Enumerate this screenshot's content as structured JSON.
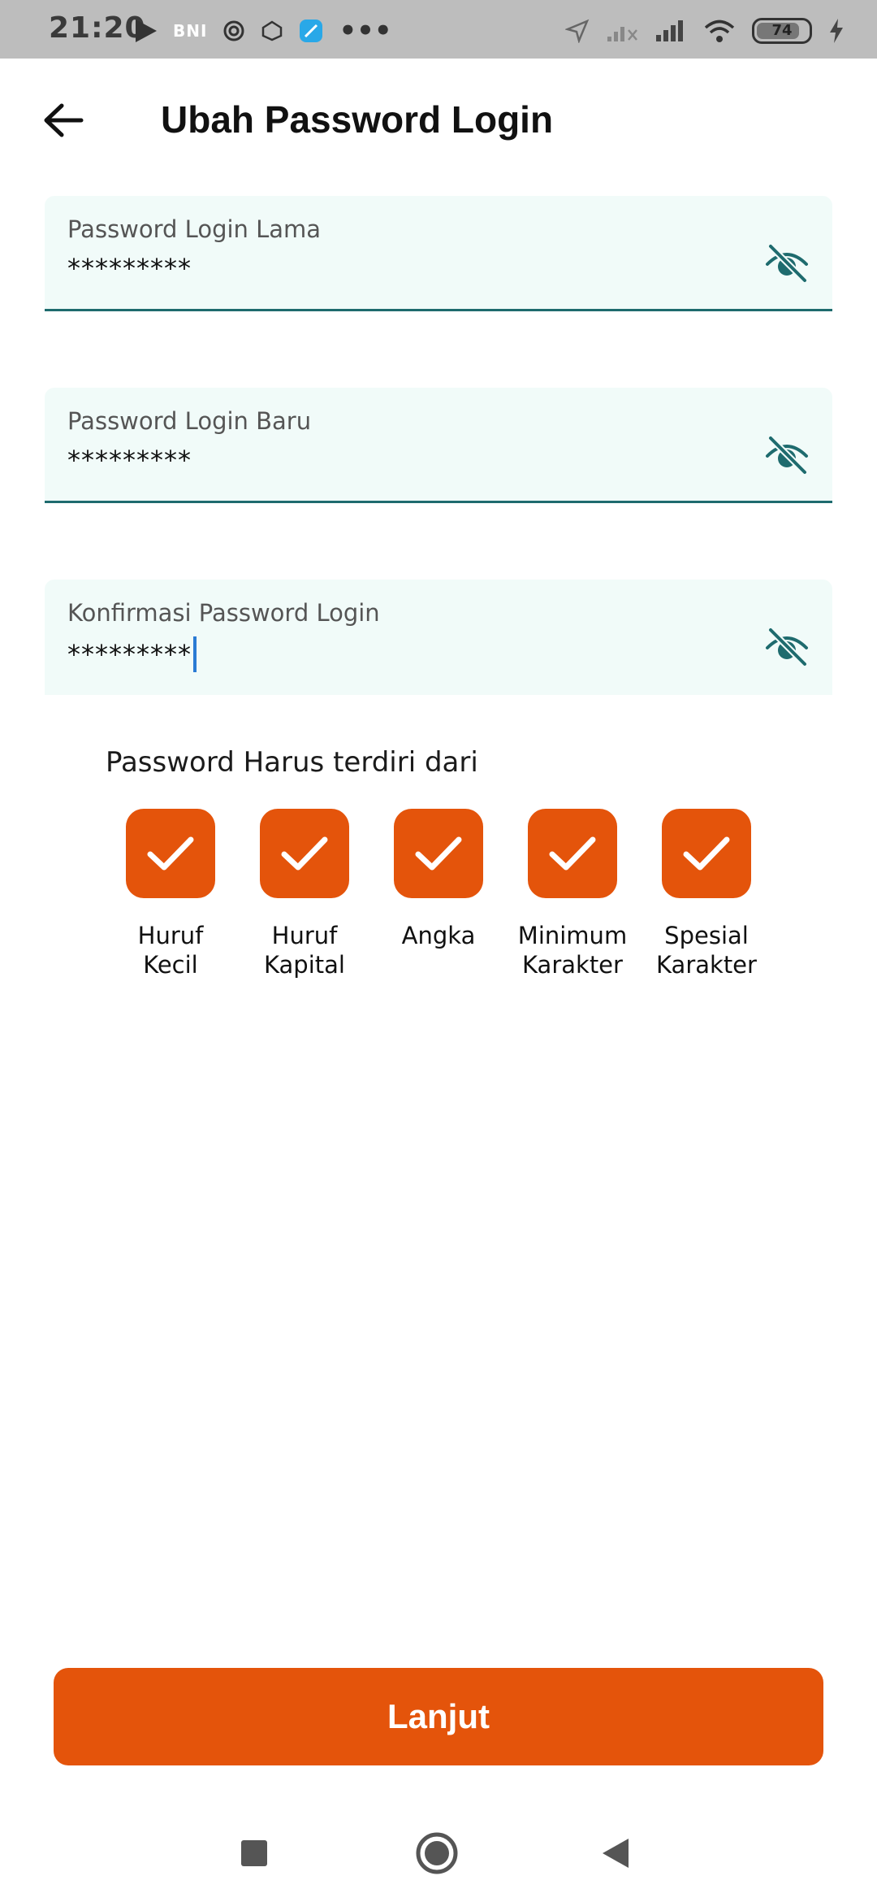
{
  "status_bar": {
    "time": "21:20",
    "carrier_tag": "BNI",
    "overflow": "•••",
    "battery": "74",
    "icons": [
      "play-store-icon",
      "bni-icon",
      "settings-icon",
      "pattern-icon",
      "app-icon",
      "location-icon",
      "signal-off-icon",
      "signal-icon",
      "wifi-icon",
      "battery-icon",
      "charging-icon"
    ]
  },
  "header": {
    "title": "Ubah Password Login",
    "back_icon": "arrow-left-icon"
  },
  "fields": [
    {
      "label": "Password Login Lama",
      "value": "*********"
    },
    {
      "label": "Password Login Baru",
      "value": "*********"
    },
    {
      "label": "Konfirmasi Password Login",
      "value": "*********"
    }
  ],
  "requirements": {
    "title": "Password Harus terdiri dari",
    "items": [
      {
        "line1": "Huruf",
        "line2": "Kecil",
        "checked": true
      },
      {
        "line1": "Huruf",
        "line2": "Kapital",
        "checked": true
      },
      {
        "line1": "Angka",
        "line2": "",
        "checked": true
      },
      {
        "line1": "Minimum",
        "line2": "Karakter",
        "checked": true
      },
      {
        "line1": "Spesial",
        "line2": "Karakter",
        "checked": true
      }
    ]
  },
  "button": {
    "label": "Lanjut"
  },
  "colors": {
    "accent": "#e4540b",
    "field_bg": "#f1fbf9",
    "underline": "#1e6b6e",
    "eye_icon": "#1e6b6e"
  },
  "navbar": {
    "icons": [
      "recents-icon",
      "home-icon",
      "back-nav-icon"
    ]
  }
}
